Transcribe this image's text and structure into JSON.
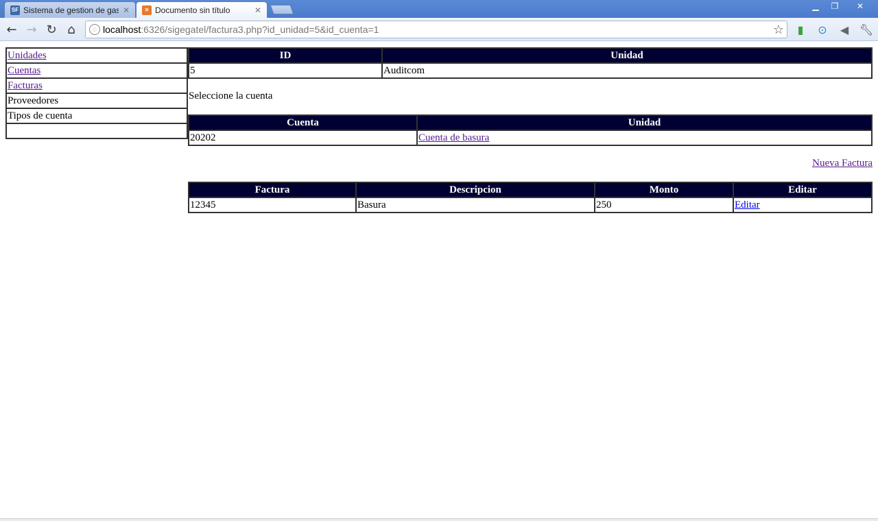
{
  "browser": {
    "tabs": [
      {
        "title": "Sistema de gestion de gastos",
        "favicon": "sf-favicon-icon",
        "active": false
      },
      {
        "title": "Documento sin título",
        "favicon": "xampp-favicon-icon",
        "active": true
      }
    ],
    "url_host": "localhost",
    "url_path": ":6326/sigegatel/factura3.php?id_unidad=5&id_cuenta=1"
  },
  "sidebar": {
    "items": [
      {
        "label": "Unidades",
        "link": true
      },
      {
        "label": "Cuentas",
        "link": true
      },
      {
        "label": "Facturas",
        "link": true
      },
      {
        "label": "Proveedores",
        "link": false
      },
      {
        "label": "Tipos de cuenta",
        "link": false
      },
      {
        "label": "",
        "link": false
      }
    ]
  },
  "unidad_table": {
    "headers": [
      "ID",
      "Unidad"
    ],
    "row": [
      "5",
      "Auditcom"
    ]
  },
  "select_label": "Seleccione la cuenta",
  "cuenta_table": {
    "headers": [
      "Cuenta",
      "Unidad"
    ],
    "row": {
      "cuenta": "20202",
      "unidad": "Cuenta de basura"
    }
  },
  "nueva_factura_link": "Nueva Factura",
  "factura_table": {
    "headers": [
      "Factura",
      "Descripcion",
      "Monto",
      "Editar"
    ],
    "row": {
      "factura": "12345",
      "descripcion": "Basura",
      "monto": "250",
      "editar": "Editar"
    }
  },
  "colors": {
    "header_bg": "#000033",
    "visited_link": "#551a8b",
    "link": "#0000ee"
  }
}
